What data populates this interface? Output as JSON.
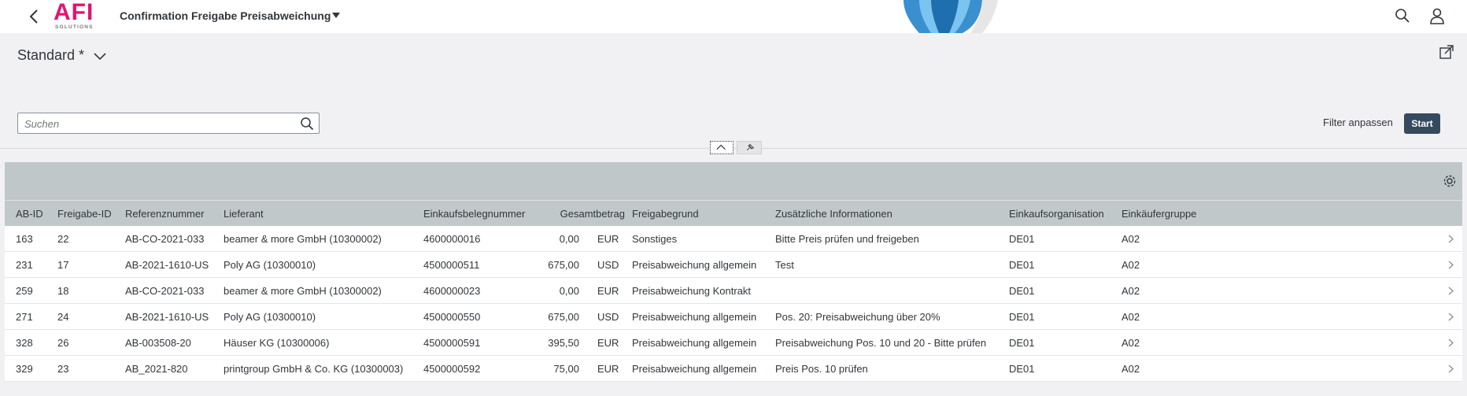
{
  "shell": {
    "logo_text": "AFI",
    "logo_sub": "SOLUTIONS",
    "app_title": "Confirmation Freigabe Preisabweichung"
  },
  "filterbar": {
    "variant": "Standard *",
    "search_placeholder": "Suchen",
    "filter_adjust": "Filter anpassen",
    "start": "Start"
  },
  "table": {
    "columns": [
      "AB-ID",
      "Freigabe-ID",
      "Referenznummer",
      "Lieferant",
      "Einkaufsbelegnummer",
      "Gesamtbetrag",
      "Freigabegrund",
      "Zusätzliche Informationen",
      "Einkaufsorganisation",
      "Einkäufergruppe"
    ],
    "rows": [
      {
        "ab_id": "163",
        "freigabe_id": "22",
        "referenz": "AB-CO-2021-033",
        "lieferant": "beamer & more GmbH (10300002)",
        "beleg": "4600000016",
        "betrag": "0,00",
        "waehrung": "EUR",
        "grund": "Sonstiges",
        "info": "Bitte Preis prüfen und freigeben",
        "org": "DE01",
        "gruppe": "A02"
      },
      {
        "ab_id": "231",
        "freigabe_id": "17",
        "referenz": "AB-2021-1610-US",
        "lieferant": "Poly AG (10300010)",
        "beleg": "4500000511",
        "betrag": "675,00",
        "waehrung": "USD",
        "grund": "Preisabweichung allgemein",
        "info": "Test",
        "org": "DE01",
        "gruppe": "A02"
      },
      {
        "ab_id": "259",
        "freigabe_id": "18",
        "referenz": "AB-CO-2021-033",
        "lieferant": "beamer & more GmbH (10300002)",
        "beleg": "4600000023",
        "betrag": "0,00",
        "waehrung": "EUR",
        "grund": "Preisabweichung Kontrakt",
        "info": "",
        "org": "DE01",
        "gruppe": "A02"
      },
      {
        "ab_id": "271",
        "freigabe_id": "24",
        "referenz": "AB-2021-1610-US",
        "lieferant": "Poly AG (10300010)",
        "beleg": "4500000550",
        "betrag": "675,00",
        "waehrung": "USD",
        "grund": "Preisabweichung allgemein",
        "info": "Pos. 20: Preisabweichung über 20%",
        "org": "DE01",
        "gruppe": "A02"
      },
      {
        "ab_id": "328",
        "freigabe_id": "26",
        "referenz": "AB-003508-20",
        "lieferant": "Häuser KG (10300006)",
        "beleg": "4500000591",
        "betrag": "395,50",
        "waehrung": "EUR",
        "grund": "Preisabweichung allgemein",
        "info": "Preisabweichung Pos. 10 und 20 - Bitte prüfen",
        "org": "DE01",
        "gruppe": "A02"
      },
      {
        "ab_id": "329",
        "freigabe_id": "23",
        "referenz": "AB_2021-820",
        "lieferant": "printgroup GmbH & Co. KG (10300003)",
        "beleg": "4500000592",
        "betrag": "75,00",
        "waehrung": "EUR",
        "grund": "Preisabweichung allgemein",
        "info": "Preis Pos. 10 prüfen",
        "org": "DE01",
        "gruppe": "A02"
      }
    ]
  },
  "colors": {
    "brand": "#e4136f",
    "button": "#354a5f",
    "table_header": "#c0c8ca"
  },
  "icons": [
    "back-icon",
    "caret-down-icon",
    "search-icon",
    "user-icon",
    "share-icon",
    "collapse-icon",
    "pin-icon",
    "gear-icon",
    "chevron-right-icon"
  ]
}
